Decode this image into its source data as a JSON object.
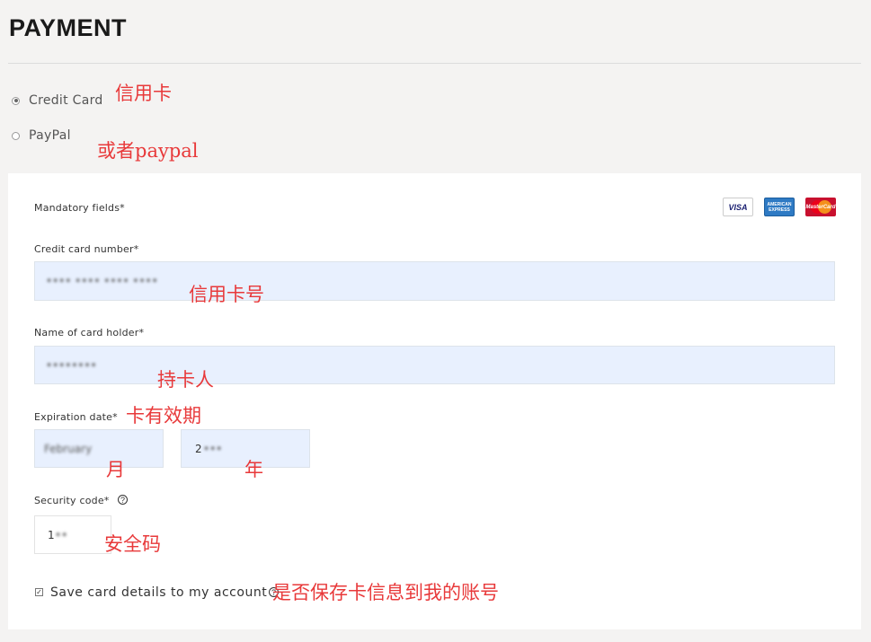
{
  "page": {
    "title": "PAYMENT"
  },
  "payment_methods": [
    {
      "label": "Credit Card",
      "selected": true
    },
    {
      "label": "PayPal",
      "selected": false
    }
  ],
  "annotations": {
    "credit_card": "信用卡",
    "paypal": "或者paypal",
    "card_number": "信用卡号",
    "card_holder": "持卡人",
    "expiration": "卡有效期",
    "month": "月",
    "year": "年",
    "security": "安全码",
    "save": "是否保存卡信息到我的账号"
  },
  "form": {
    "mandatory": "Mandatory fields*",
    "card_number_label": "Credit card number*",
    "card_number_value": "•••• •••• •••• ••••",
    "holder_label": "Name of card holder*",
    "holder_value": "••••••••",
    "expiration_label": "Expiration date*",
    "month_value": "February",
    "year_value": "2",
    "security_label": "Security code*",
    "security_value": "1",
    "save_label": "Save card details to my account",
    "save_checked": true,
    "help_glyph": "?"
  },
  "card_logos": [
    {
      "name": "VISA",
      "icon": "visa-icon"
    },
    {
      "name": "AMERICAN EXPRESS",
      "icon": "amex-icon"
    },
    {
      "name": "MasterCard",
      "icon": "mastercard-icon"
    }
  ]
}
